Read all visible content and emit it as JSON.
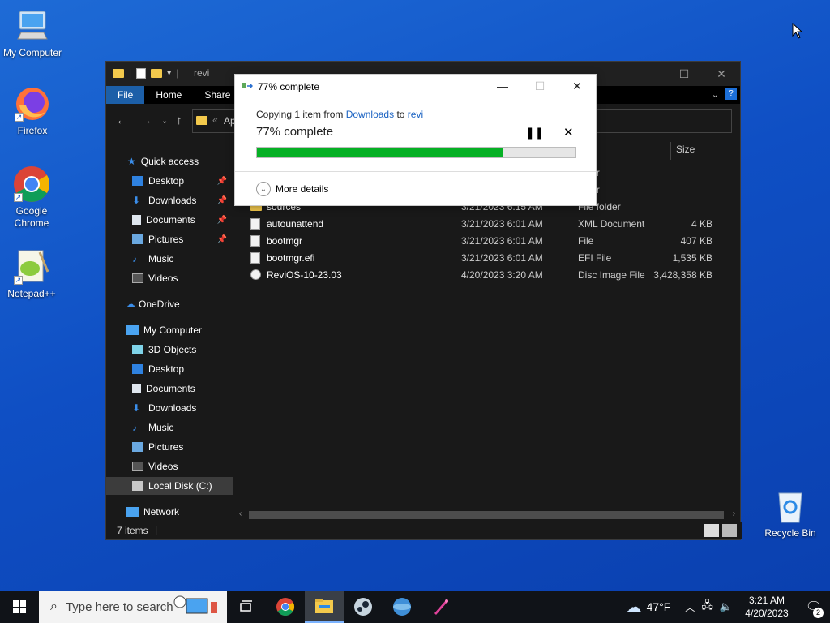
{
  "desktop": {
    "icons": [
      {
        "label": "My Computer",
        "icon": "computer-icon"
      },
      {
        "label": "Firefox",
        "icon": "firefox-icon"
      },
      {
        "label": "Google Chrome",
        "icon": "chrome-icon"
      },
      {
        "label": "Notepad++",
        "icon": "notepadpp-icon"
      },
      {
        "label": "Recycle Bin",
        "icon": "recycle-bin-icon"
      }
    ]
  },
  "explorer": {
    "title": "revi",
    "ribbon_tabs": [
      "File",
      "Home",
      "Share"
    ],
    "address_visible": "Ap",
    "sidebar": {
      "quick_access": "Quick access",
      "quick_items": [
        "Desktop",
        "Downloads",
        "Documents",
        "Pictures",
        "Music",
        "Videos"
      ],
      "onedrive": "OneDrive",
      "my_computer": "My Computer",
      "pc_items": [
        "3D Objects",
        "Desktop",
        "Documents",
        "Downloads",
        "Music",
        "Pictures",
        "Videos",
        "Local Disk (C:)"
      ],
      "network": "Network"
    },
    "columns": {
      "size": "Size"
    },
    "files": [
      {
        "name": "",
        "date": "",
        "type": "older",
        "size": ""
      },
      {
        "name": "",
        "date": "",
        "type": "older",
        "size": ""
      },
      {
        "name": "sources",
        "date": "3/21/2023 6:15 AM",
        "type": "File folder",
        "size": ""
      },
      {
        "name": "autounattend",
        "date": "3/21/2023 6:01 AM",
        "type": "XML Document",
        "size": "4 KB"
      },
      {
        "name": "bootmgr",
        "date": "3/21/2023 6:01 AM",
        "type": "File",
        "size": "407 KB"
      },
      {
        "name": "bootmgr.efi",
        "date": "3/21/2023 6:01 AM",
        "type": "EFI File",
        "size": "1,535 KB"
      },
      {
        "name": "ReviOS-10-23.03",
        "date": "4/20/2023 3:20 AM",
        "type": "Disc Image File",
        "size": "3,428,358 KB"
      }
    ],
    "status_count": "7 items"
  },
  "dialog": {
    "title": "77% complete",
    "line_prefix": "Copying 1 item from",
    "source": "Downloads",
    "line_to": "to",
    "dest": "revi",
    "percent_text": "77% complete",
    "progress": 0.77,
    "more_details": "More details"
  },
  "taskbar": {
    "search_placeholder": "Type here to search",
    "weather": "47°F",
    "time": "3:21 AM",
    "date": "4/20/2023",
    "notification_count": "2"
  },
  "colors": {
    "progress_fill": "#06b025",
    "link": "#1a62c2",
    "desktop_blue": "#0f4fc4"
  }
}
